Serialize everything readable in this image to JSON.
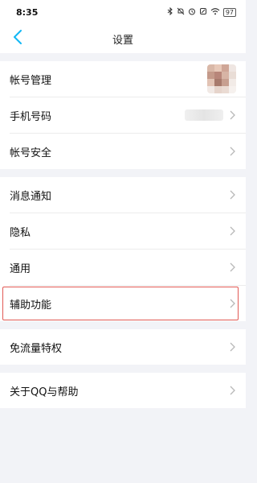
{
  "status": {
    "time": "8:35",
    "icons": [
      "bluetooth-icon",
      "mute-icon",
      "alarm-icon",
      "silent-icon",
      "wifi-icon"
    ],
    "battery": "97"
  },
  "nav": {
    "title": "设置",
    "accent": "#12b7f5"
  },
  "groups": [
    {
      "items": [
        {
          "label": "帐号管理",
          "right": "avatar"
        },
        {
          "label": "手机号码",
          "right": "blurred"
        },
        {
          "label": "帐号安全",
          "right": "none"
        }
      ]
    },
    {
      "items": [
        {
          "label": "消息通知"
        },
        {
          "label": "隐私"
        },
        {
          "label": "通用"
        },
        {
          "label": "辅助功能",
          "highlighted": true
        }
      ]
    },
    {
      "items": [
        {
          "label": "免流量特权"
        }
      ]
    },
    {
      "items": [
        {
          "label": "关于QQ与帮助"
        }
      ]
    }
  ],
  "colors": {
    "background": "#f2f3f7",
    "highlight_border": "#e15a55"
  }
}
